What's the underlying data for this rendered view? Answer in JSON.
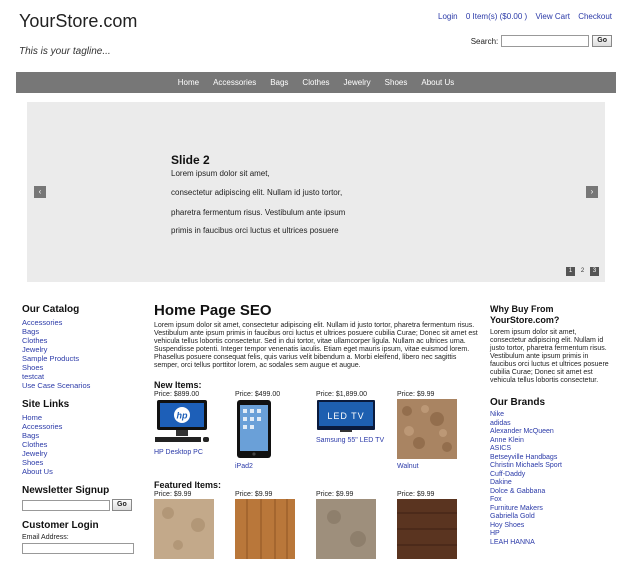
{
  "header": {
    "logo": "YourStore.com",
    "tagline": "This is your tagline...",
    "links": [
      "Login",
      "0 Item(s) ($0.00 )",
      "View Cart",
      "Checkout"
    ],
    "search_label": "Search:",
    "search_button": "Go"
  },
  "nav": [
    "Home",
    "Accessories",
    "Bags",
    "Clothes",
    "Jewelry",
    "Shoes",
    "About Us"
  ],
  "slider": {
    "title": "Slide 2",
    "lines": [
      "Lorem ipsum dolor sit amet,",
      "consectetur adipiscing elit. Nullam id justo tortor,",
      "pharetra fermentum risus. Vestibulum ante ipsum",
      "primis in faucibus orci luctus et ultrices posuere"
    ],
    "prev": "‹",
    "next": "›",
    "pages": [
      "1",
      "2",
      "3"
    ],
    "current_page": "2"
  },
  "catalog": {
    "heading": "Our Catalog",
    "items": [
      "Accessories",
      "Bags",
      "Clothes",
      "Jewelry",
      "Sample Products",
      "Shoes",
      "testcat",
      "Use Case Scenarios"
    ]
  },
  "site_links": {
    "heading": "Site Links",
    "items": [
      "Home",
      "Accessories",
      "Bags",
      "Clothes",
      "Jewelry",
      "Shoes",
      "About Us"
    ]
  },
  "newsletter": {
    "heading": "Newsletter Signup",
    "button": "Go"
  },
  "login": {
    "heading": "Customer Login",
    "email_label": "Email Address:"
  },
  "main": {
    "title": "Home Page SEO",
    "intro": "Lorem ipsum dolor sit amet, consectetur adipiscing elit. Nullam id justo tortor, pharetra fermentum risus. Vestibulum ante ipsum primis in faucibus orci luctus et ultrices posuere cubilia Curae; Donec sit amet est vehicula tellus lobortis consectetur. Sed in dui tortor, vitae ullamcorper ligula. Nullam ac ultrices urna. Suspendisse potenti. Integer tempor venenatis iaculis. Etiam eget mauris ipsum, vitae euismod lorem. Phasellus posuere consequat felis, quis varius velit bibendum a. Morbi eleifend, libero nec sagittis semper, orci tellus porttitor lorem, ac sodales sem augue et augue.",
    "new_items_heading": "New Items:",
    "new_items": [
      {
        "price": "Price: $899.00",
        "name": "HP Desktop PC",
        "img": "hp-desktop"
      },
      {
        "price": "Price: $499.00",
        "name": "iPad2",
        "img": "ipad"
      },
      {
        "price": "Price: $1,899.00",
        "name": "Samsung 55\" LED TV",
        "img": "led-tv"
      },
      {
        "price": "Price: $9.99",
        "name": "Walnut",
        "img": "stone"
      }
    ],
    "featured_heading": "Featured Items:",
    "featured_items": [
      {
        "price": "Price: $9.99",
        "img": "stone-light"
      },
      {
        "price": "Price: $9.99",
        "img": "wood"
      },
      {
        "price": "Price: $9.99",
        "img": "stone-gray"
      },
      {
        "price": "Price: $9.99",
        "img": "dark-wood"
      }
    ]
  },
  "why": {
    "heading": "Why Buy From YourStore.com?",
    "text": "Lorem ipsum dolor sit amet, consectetur adipiscing elit. Nullam id justo tortor, pharetra fermentum risus. Vestibulum ante ipsum primis in faucibus orci luctus et ultrices posuere cubilia Curae; Donec sit amet est vehicula tellus lobortis consectetur."
  },
  "brands": {
    "heading": "Our Brands",
    "items": [
      "Nike",
      "adidas",
      "Alexander McQueen",
      "Anne Klein",
      "ASICS",
      "Betseyville Handbags",
      "Christin Michaels Sport",
      "Cuff-Daddy",
      "Dakine",
      "Dolce & Gabbana",
      "Fox",
      "Furniture Makers",
      "Gabriella Gold",
      "Hoy Shoes",
      "HP",
      "LEAH HANNA"
    ]
  },
  "colors": {
    "link": "#2b3aa8",
    "nav_bg": "#777777",
    "slider_bg": "#ebebeb"
  }
}
